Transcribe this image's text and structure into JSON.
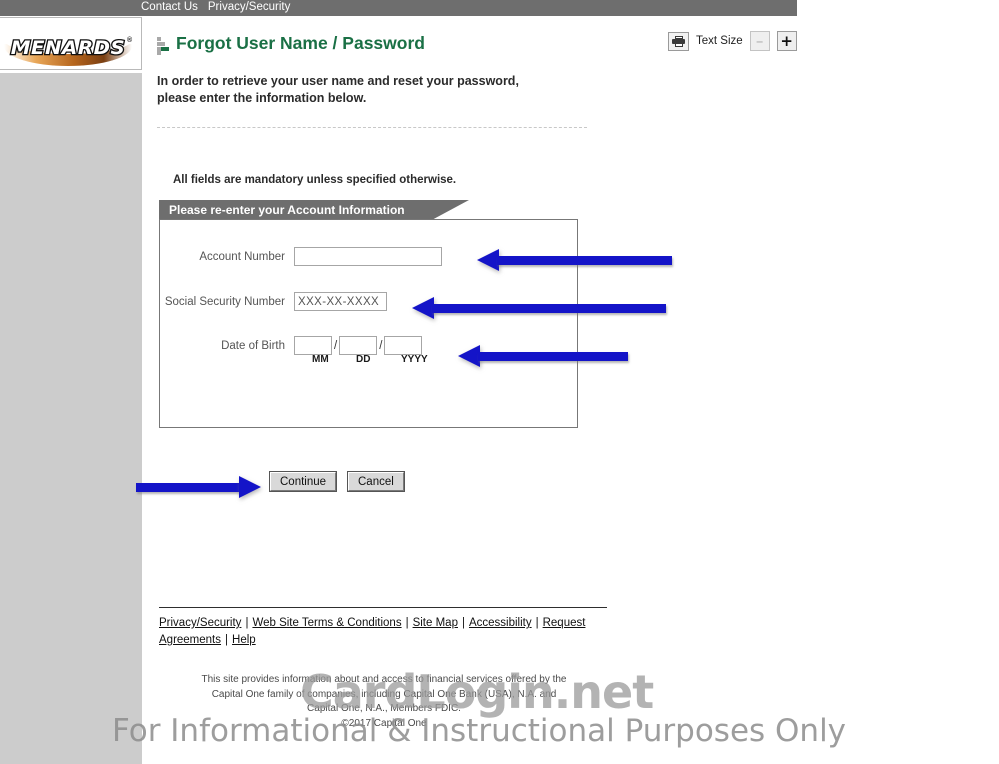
{
  "topbar": {
    "links": [
      {
        "label": "Contact Us"
      },
      {
        "label": "Privacy/Security"
      }
    ]
  },
  "brand": {
    "logo_text": "MENARDS",
    "registered_mark": "®"
  },
  "header": {
    "page_title": "Forgot User Name / Password",
    "intro_line1": "In order to retrieve your user name and reset your password,",
    "intro_line2": "please enter the information below."
  },
  "text_size": {
    "print_icon": "printer-icon",
    "label": "Text Size",
    "decrease_label": "–",
    "increase_label": "+"
  },
  "form": {
    "mandatory_note": "All fields are mandatory unless specified otherwise.",
    "section_title": "Please re-enter your Account Information",
    "fields": {
      "account_number": {
        "label": "Account Number",
        "value": "",
        "placeholder": ""
      },
      "social_security_number": {
        "label": "Social Security Number",
        "value": "XXX-XX-XXXX",
        "placeholder": "XXX-XX-XXXX"
      },
      "date_of_birth": {
        "label": "Date of Birth",
        "month_value": "",
        "day_value": "",
        "year_value": "",
        "separator": "/",
        "month_hint": "MM",
        "day_hint": "DD",
        "year_hint": "YYYY"
      }
    }
  },
  "actions": {
    "continue_label": "Continue",
    "cancel_label": "Cancel"
  },
  "footer": {
    "links": [
      {
        "label": "Privacy/Security"
      },
      {
        "label": "Web Site Terms & Conditions"
      },
      {
        "label": "Site Map"
      },
      {
        "label": "Accessibility"
      },
      {
        "label": "Request Agreements"
      },
      {
        "label": "Help"
      }
    ],
    "separator": "|",
    "legal_line1": "This site provides information about and access to financial services offered by the",
    "legal_line2": "Capital One family of companies, including Capital One Bank (USA), N.A. and",
    "legal_line3": "Capital One, N.A., Members FDIC.",
    "copyright": "©2017 Capital One"
  },
  "watermark": {
    "brand": "CardLogin.net",
    "tagline": "For Informational & Instructional Purposes Only"
  },
  "annotations": {
    "accent_color": "#1414c8",
    "arrow_account_number": "points-left-to-account-number-field",
    "arrow_ssn": "points-left-to-ssn-field",
    "arrow_dob": "points-left-to-date-of-birth-field",
    "arrow_continue": "points-right-to-continue-button"
  }
}
